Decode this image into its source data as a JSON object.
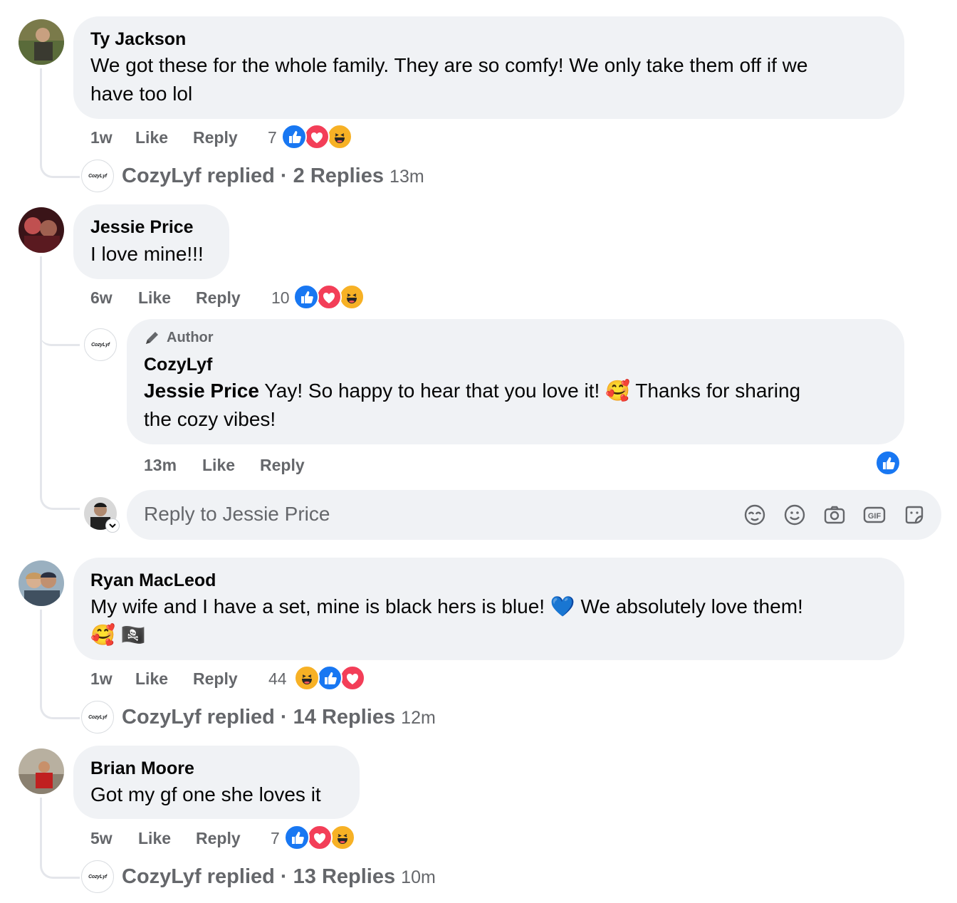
{
  "comments": [
    {
      "author": "Ty Jackson",
      "line1": "We got these for the whole family. They are so comfy! We only take them off if we",
      "line2": "have too lol",
      "time": "1w",
      "like": "Like",
      "reply": "Reply",
      "reaction_count": "7",
      "reactions": [
        "like-icon",
        "love-icon",
        "haha-icon"
      ],
      "replied_by": "CozyLyf replied",
      "replies": "· 2 Replies",
      "replied_time": "13m"
    },
    {
      "author": "Jessie Price",
      "line1": "I love mine!!!",
      "time": "6w",
      "like": "Like",
      "reply": "Reply",
      "reaction_count": "10",
      "reactions": [
        "like-icon",
        "love-icon",
        "haha-icon"
      ]
    },
    {
      "author": "Ryan MacLeod",
      "line1": "My wife and I have a set, mine is black hers is blue! 💙 We absolutely love them!",
      "line2": "🥰 🏴‍☠️",
      "time": "1w",
      "like": "Like",
      "reply": "Reply",
      "reaction_count": "44",
      "reactions": [
        "haha-icon",
        "like-icon",
        "love-icon"
      ],
      "replied_by": "CozyLyf replied",
      "replies": "· 14 Replies",
      "replied_time": "12m"
    },
    {
      "author": "Brian Moore",
      "line1": "Got my gf one she loves it",
      "time": "5w",
      "like": "Like",
      "reply": "Reply",
      "reaction_count": "7",
      "reactions": [
        "like-icon",
        "love-icon",
        "haha-icon"
      ],
      "replied_by": "CozyLyf replied",
      "replies": "· 13 Replies",
      "replied_time": "10m"
    }
  ],
  "author_reply": {
    "badge": "Author",
    "author": "CozyLyf",
    "mention": "Jessie Price",
    "line1": "Yay! So happy to hear that you love it! 🥰 Thanks for sharing",
    "line2": "the cozy vibes!",
    "time": "13m",
    "like": "Like",
    "reply": "Reply"
  },
  "reply_input": {
    "placeholder": "Reply to Jessie Price",
    "tools": [
      "avatar-sticker-icon",
      "emoji-icon",
      "camera-icon",
      "gif-icon",
      "sticker-icon"
    ]
  },
  "page_logo": "CozyLyf",
  "colors": {
    "bubble": "#f0f2f5",
    "meta": "#65676b",
    "like": "#1877f2",
    "love": "#f33e58",
    "haha": "#f7b125"
  }
}
